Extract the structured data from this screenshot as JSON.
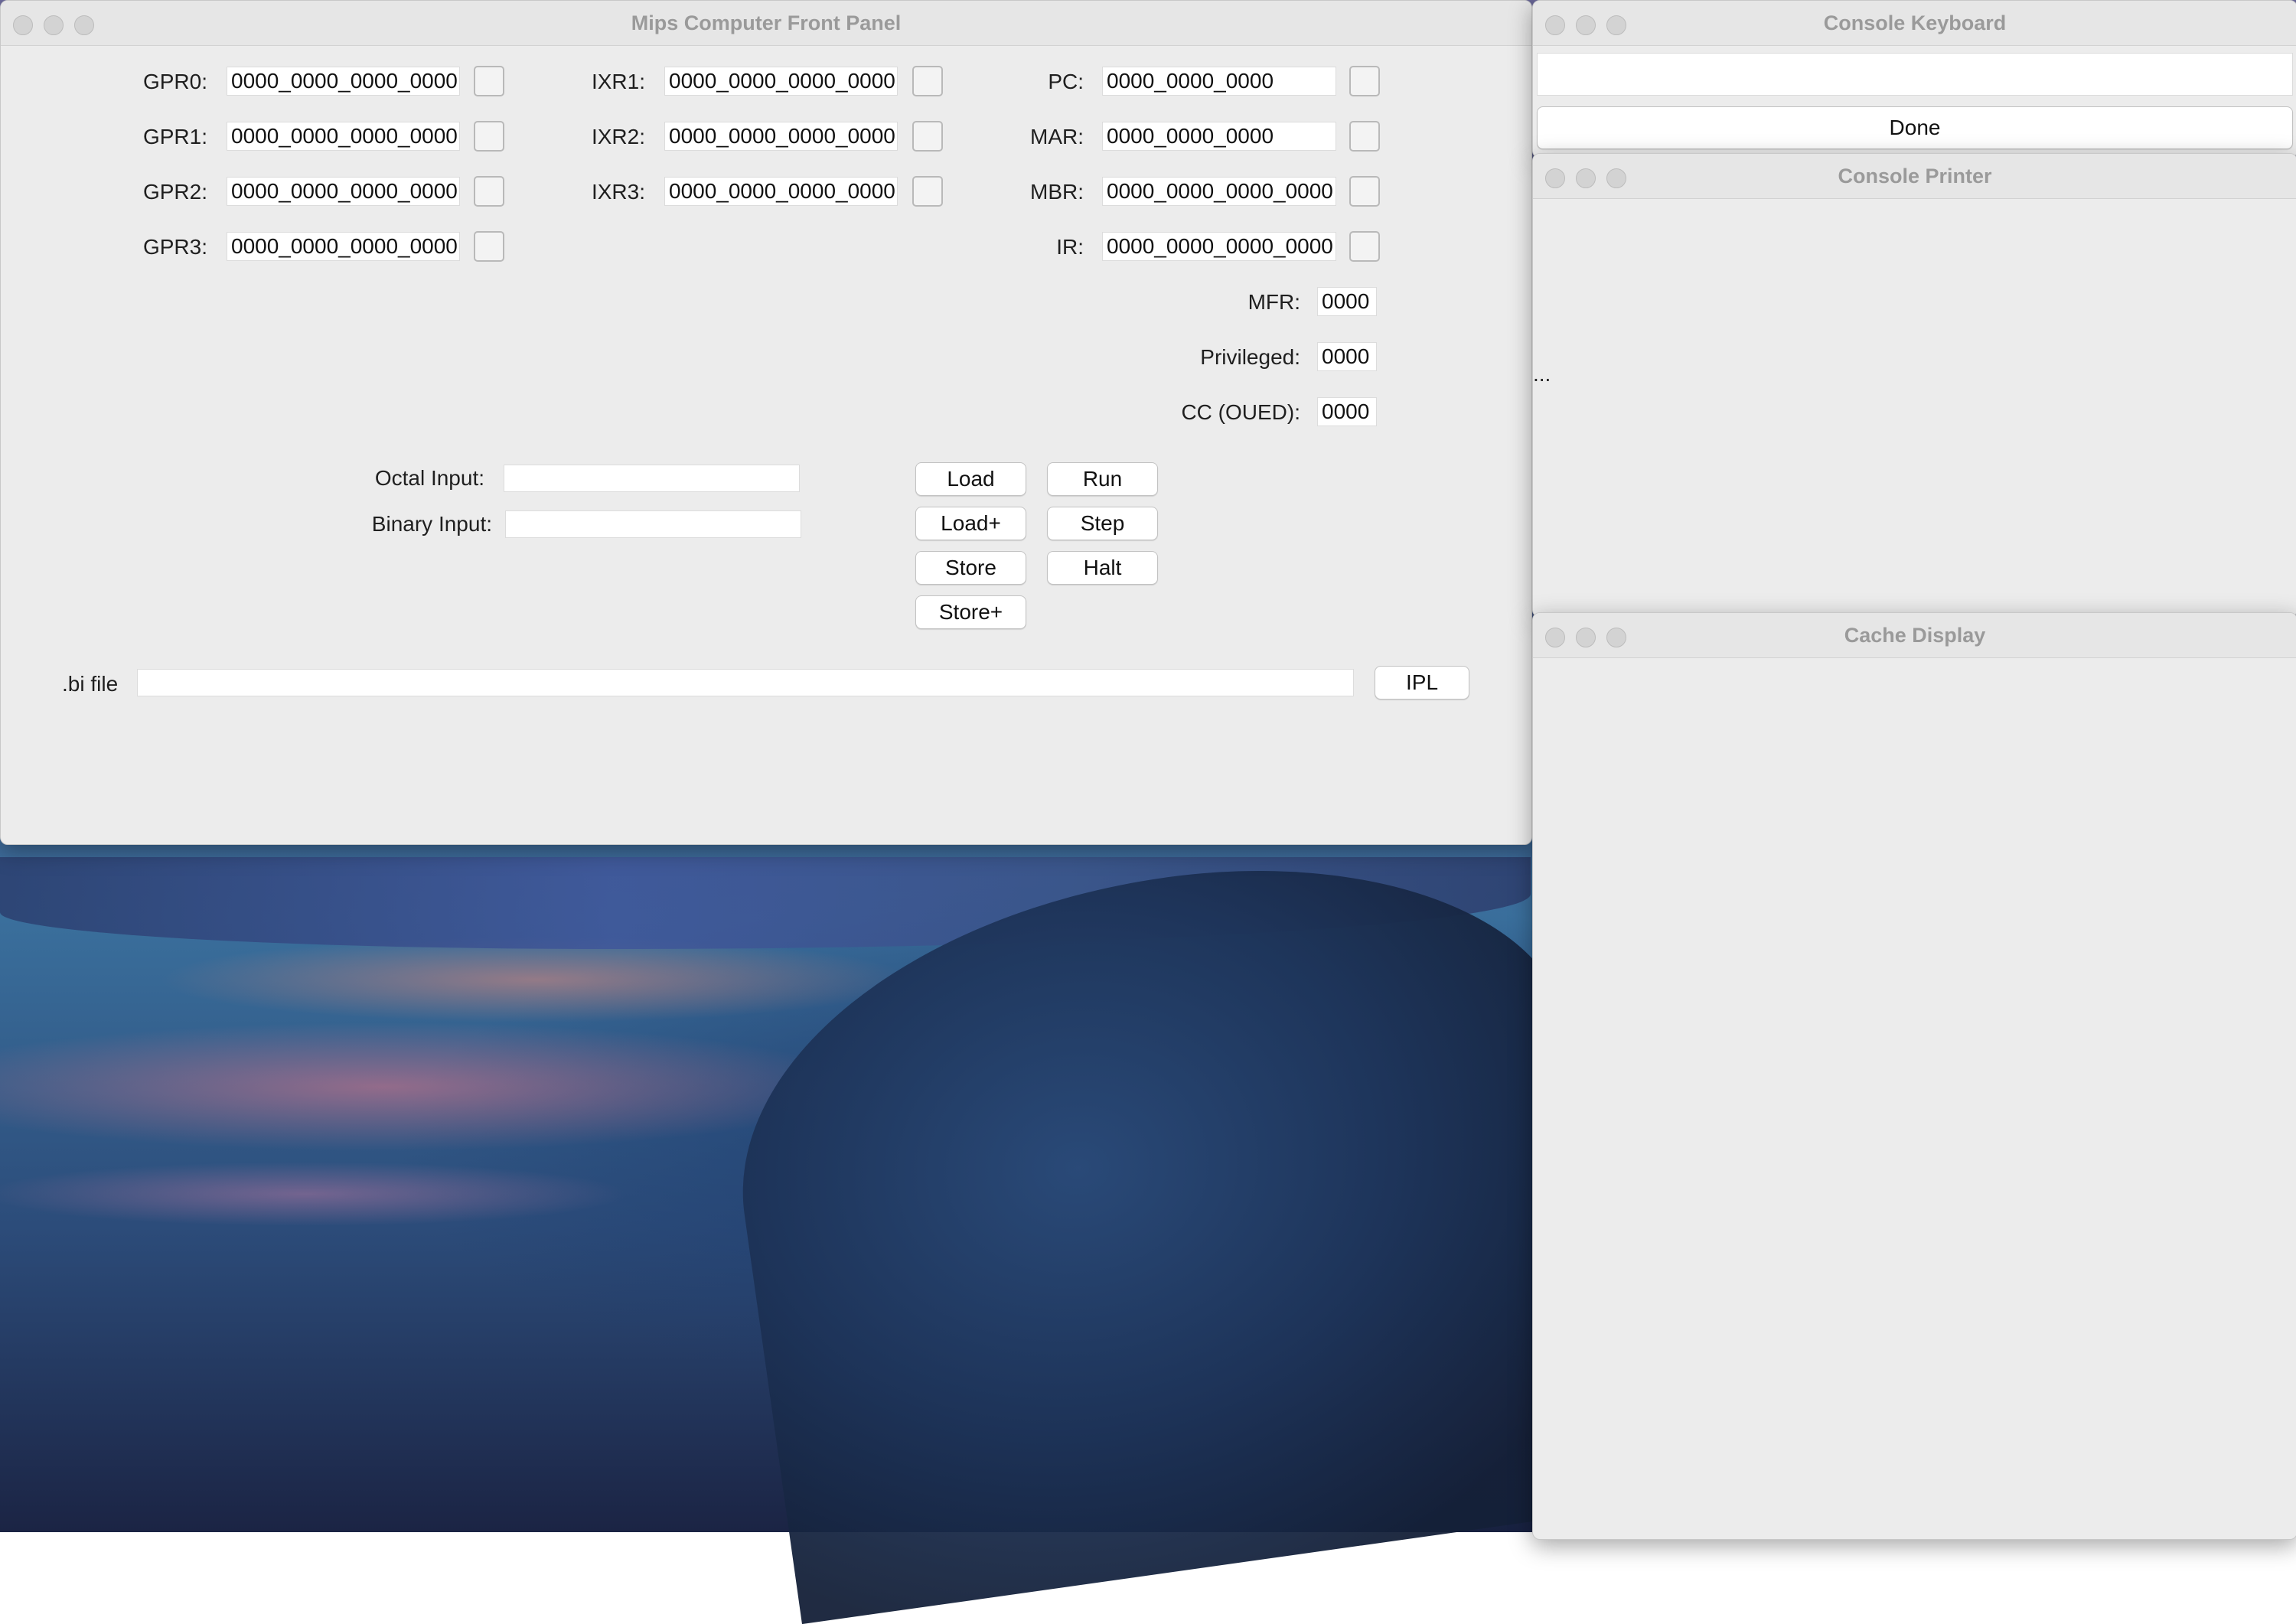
{
  "front_panel": {
    "title": "Mips Computer Front Panel",
    "gpr": [
      {
        "label": "GPR0:",
        "value": "0000_0000_0000_0000"
      },
      {
        "label": "GPR1:",
        "value": "0000_0000_0000_0000"
      },
      {
        "label": "GPR2:",
        "value": "0000_0000_0000_0000"
      },
      {
        "label": "GPR3:",
        "value": "0000_0000_0000_0000"
      }
    ],
    "ixr": [
      {
        "label": "IXR1:",
        "value": "0000_0000_0000_0000"
      },
      {
        "label": "IXR2:",
        "value": "0000_0000_0000_0000"
      },
      {
        "label": "IXR3:",
        "value": "0000_0000_0000_0000"
      }
    ],
    "special": [
      {
        "label": "PC:",
        "value": "0000_0000_0000"
      },
      {
        "label": "MAR:",
        "value": "0000_0000_0000"
      },
      {
        "label": "MBR:",
        "value": "0000_0000_0000_0000"
      },
      {
        "label": "IR:",
        "value": "0000_0000_0000_0000"
      }
    ],
    "flags": [
      {
        "label": "MFR:",
        "value": "0000"
      },
      {
        "label": "Privileged:",
        "value": "0000"
      },
      {
        "label": "CC (OUED):",
        "value": "0000"
      }
    ],
    "octal_input": {
      "label": "Octal Input:",
      "value": ""
    },
    "binary_input": {
      "label": "Binary Input:",
      "value": ""
    },
    "buttons": {
      "load": "Load",
      "run": "Run",
      "load_plus": "Load+",
      "step": "Step",
      "store": "Store",
      "halt": "Halt",
      "store_plus": "Store+",
      "ipl": "IPL"
    },
    "bi_file": {
      "label": ".bi file",
      "value": ""
    }
  },
  "console_keyboard": {
    "title": "Console Keyboard",
    "input_value": "",
    "done_label": "Done"
  },
  "console_printer": {
    "title": "Console Printer",
    "overflow_text": "..."
  },
  "cache_display": {
    "title": "Cache Display"
  }
}
